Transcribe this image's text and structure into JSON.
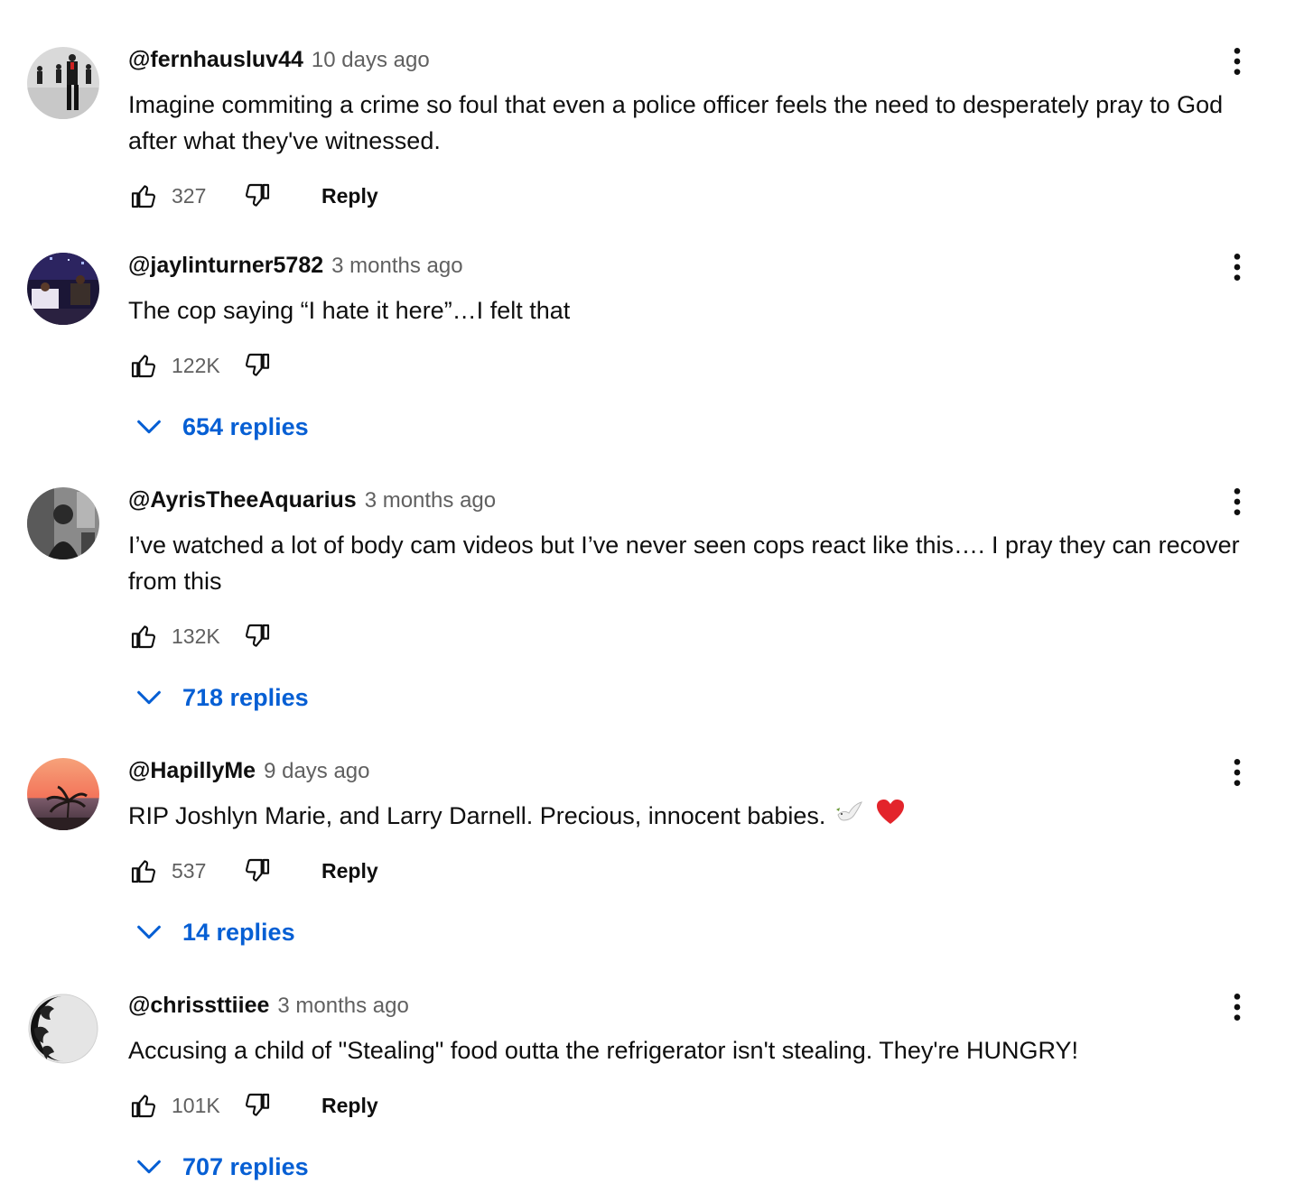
{
  "comments": [
    {
      "author": "@fernhausluv44",
      "time": "10 days ago",
      "text": "Imagine commiting a crime so foul that even a police officer feels the need to desperately pray to God after what they've witnessed.",
      "likes": "327",
      "reply_label": "Reply",
      "replies": ""
    },
    {
      "author": "@jaylinturner5782",
      "time": "3 months ago",
      "text": "The cop saying “I hate it here”…I felt that",
      "likes": "122K",
      "reply_label": "",
      "replies": "654 replies"
    },
    {
      "author": "@AyrisTheeAquarius",
      "time": "3 months ago",
      "text": "I’ve watched a lot of body cam videos but I’ve never seen cops react like this…. I pray they can recover from this",
      "likes": "132K",
      "reply_label": "",
      "replies": "718 replies"
    },
    {
      "author": "@HapillyMe",
      "time": "9 days ago",
      "text": "RIP Joshlyn Marie, and Larry Darnell. Precious,  innocent babies.",
      "likes": "537",
      "reply_label": "Reply",
      "replies": "14 replies",
      "emojis": [
        "dove-emoji",
        "red-heart-emoji"
      ]
    },
    {
      "author": "@chrissttiiee",
      "time": "3 months ago",
      "text": "Accusing a child of \"Stealing\" food outta the refrigerator isn't stealing. They're HUNGRY!",
      "likes": "101K",
      "reply_label": "Reply",
      "replies": "707 replies"
    }
  ],
  "icons": {
    "like": "thumbs-up-icon",
    "dislike": "thumbs-down-icon",
    "more": "vertical-dots-icon",
    "expand": "chevron-down-icon"
  },
  "colors": {
    "link_blue": "#065fd4",
    "secondary_text": "#606060",
    "primary_text": "#0f0f0f"
  }
}
